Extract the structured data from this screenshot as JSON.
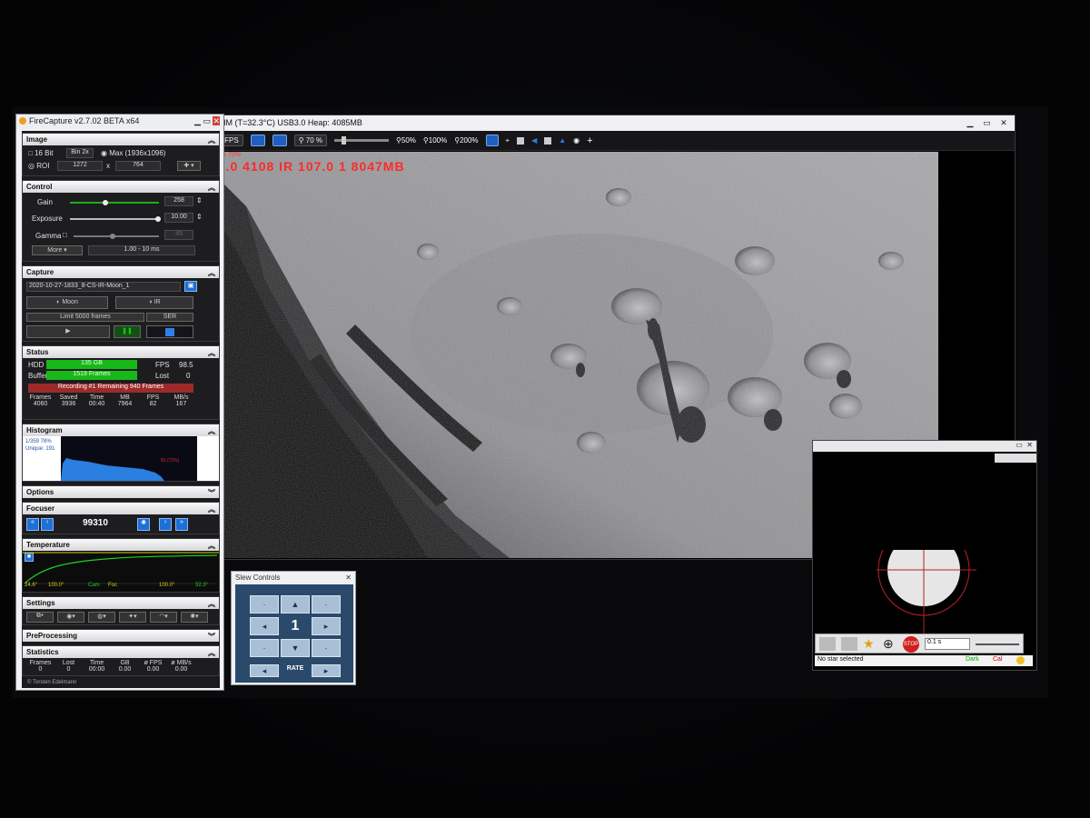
{
  "capture_window": {
    "title": "90MM (T=32.3°C) USB3.0    Heap: 4085MB",
    "toolbar": {
      "fps": "15 FPS",
      "zoom_pct": "70 %",
      "zoom_50": "50%",
      "zoom_100": "100%",
      "zoom_200": "200%"
    },
    "overlay_zoom": "Zoom 70%",
    "overlay_stats": "41.0  4108  IR  107.0  1  8047MB"
  },
  "fc": {
    "title": "FireCapture v2.7.02 BETA x64",
    "image": {
      "header": "Image",
      "bit16": "16 Bit",
      "bin2x": "Bin 2x",
      "max": "Max (1936x1096)",
      "roi": "ROI",
      "roi_w": "1272",
      "roi_x": "x",
      "roi_h": "764"
    },
    "control": {
      "header": "Control",
      "gain_label": "Gain",
      "gain_value": "258",
      "exposure_label": "Exposure",
      "exposure_value": "10.00",
      "gamma_label": "Gamma",
      "gamma_value": "49",
      "more": "More",
      "range": "1.00 - 10 ms"
    },
    "capture": {
      "header": "Capture",
      "filename": "2020-10-27-1833_8-CS-IR-Moon_1",
      "target": "Moon",
      "filter": "IR",
      "limit": "Limit 5000 frames",
      "format": "SER"
    },
    "status": {
      "header": "Status",
      "hdd_label": "HDD",
      "hdd_value": "135 GB",
      "buffer_label": "Buffer",
      "buffer_value": "1519 Frames",
      "fps_label": "FPS",
      "fps_value": "98.5",
      "lost_label": "Lost",
      "lost_value": "0",
      "recording": "Recording #1    Remaining  940 Frames",
      "cols": [
        "Frames",
        "Saved",
        "Time",
        "MB",
        "FPS",
        "MB/s"
      ],
      "vals": [
        "4060",
        "3936",
        "00:40",
        "7964",
        "82",
        "167"
      ]
    },
    "histogram": {
      "header": "Histogram",
      "line1": "1/359 78%",
      "line2": "Unique: 191",
      "marker": "81 (71%)"
    },
    "options": {
      "header": "Options"
    },
    "focuser": {
      "header": "Focuser",
      "value": "99310"
    },
    "temperature": {
      "header": "Temperature",
      "left": "24.6°",
      "mid1": "100.0°",
      "cam": "Cam",
      "foc": "Foc",
      "mid2": "100.0°",
      "right": "32.3°"
    },
    "settings": {
      "header": "Settings"
    },
    "preprocessing": {
      "header": "PreProcessing"
    },
    "statistics": {
      "header": "Statistics",
      "cols": [
        "Frames",
        "Lost",
        "Time",
        "GB",
        "ø FPS",
        "ø MB/s"
      ],
      "vals": [
        "0",
        "0",
        "00:00",
        "0.00",
        "0.00",
        "0.00"
      ]
    },
    "footer": "© Torsten Edelmann"
  },
  "slew": {
    "title": "Slew Controls",
    "rate_value": "1",
    "rate_label": "RATE"
  },
  "guide": {
    "exposure": "0.1 s",
    "status": "No star selected",
    "dark": "Dark",
    "cal": "Cal"
  }
}
